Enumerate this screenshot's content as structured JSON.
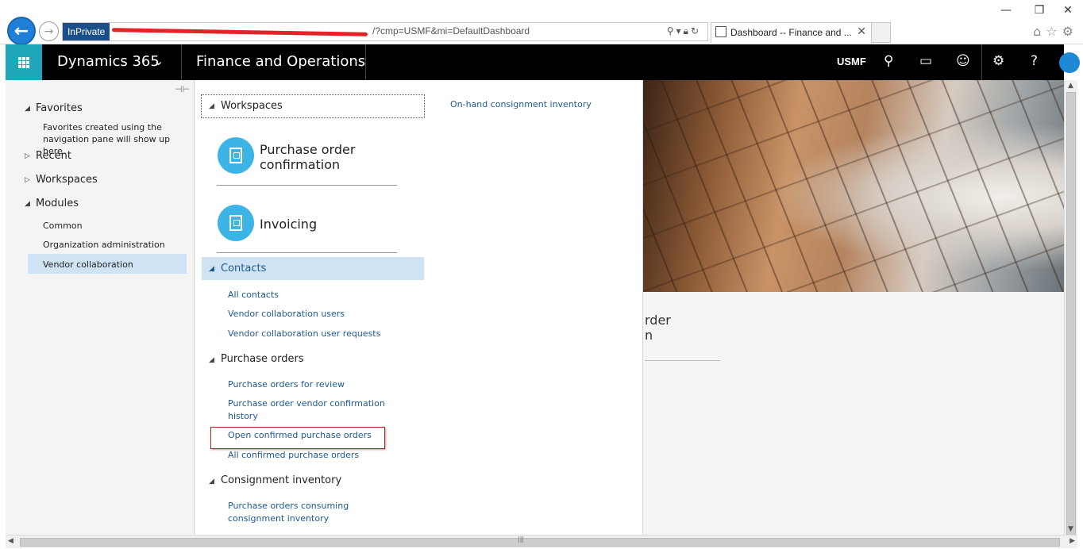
{
  "browser": {
    "inprivate_label": "InPrivate",
    "url_visible": "/?cmp=USMF&mi=DefaultDashboard",
    "tab_title": "Dashboard -- Finance and ...",
    "win_min": "—",
    "win_restore": "❐",
    "win_close": "✕"
  },
  "header": {
    "brand": "Dynamics 365",
    "module_title": "Finance and Operations",
    "company": "USMF"
  },
  "nav": {
    "favorites": "Favorites",
    "favorites_hint_line1": "Favorites created using the",
    "favorites_hint_line2": "navigation pane will show up here.",
    "recent": "Recent",
    "workspaces": "Workspaces",
    "modules": "Modules",
    "module_items": [
      "Common",
      "Organization administration",
      "Vendor collaboration"
    ]
  },
  "flyout": {
    "workspaces_header": "Workspaces",
    "tiles": [
      {
        "line1": "Purchase order",
        "line2": "confirmation"
      },
      {
        "line1": "Invoicing",
        "line2": ""
      }
    ],
    "right_link": "On-hand consignment inventory",
    "contacts": {
      "header": "Contacts",
      "links": [
        "All contacts",
        "Vendor collaboration users",
        "Vendor collaboration user requests"
      ]
    },
    "purchase_orders": {
      "header": "Purchase orders",
      "links": [
        "Purchase orders for review",
        "Purchase order vendor confirmation",
        "history",
        "Open confirmed purchase orders",
        "All confirmed purchase orders"
      ]
    },
    "consignment": {
      "header": "Consignment inventory",
      "links": [
        "Purchase orders consuming",
        "consignment inventory"
      ]
    }
  },
  "dashboard": {
    "tile_partial_line1": "rder",
    "tile_partial_line2": "n"
  },
  "colors": {
    "waffle": "#1fa6b8",
    "selected": "#cfe3f5",
    "link": "#1d5a92",
    "tile_circle": "#3cb4e5",
    "highlight": "#b5262b"
  }
}
